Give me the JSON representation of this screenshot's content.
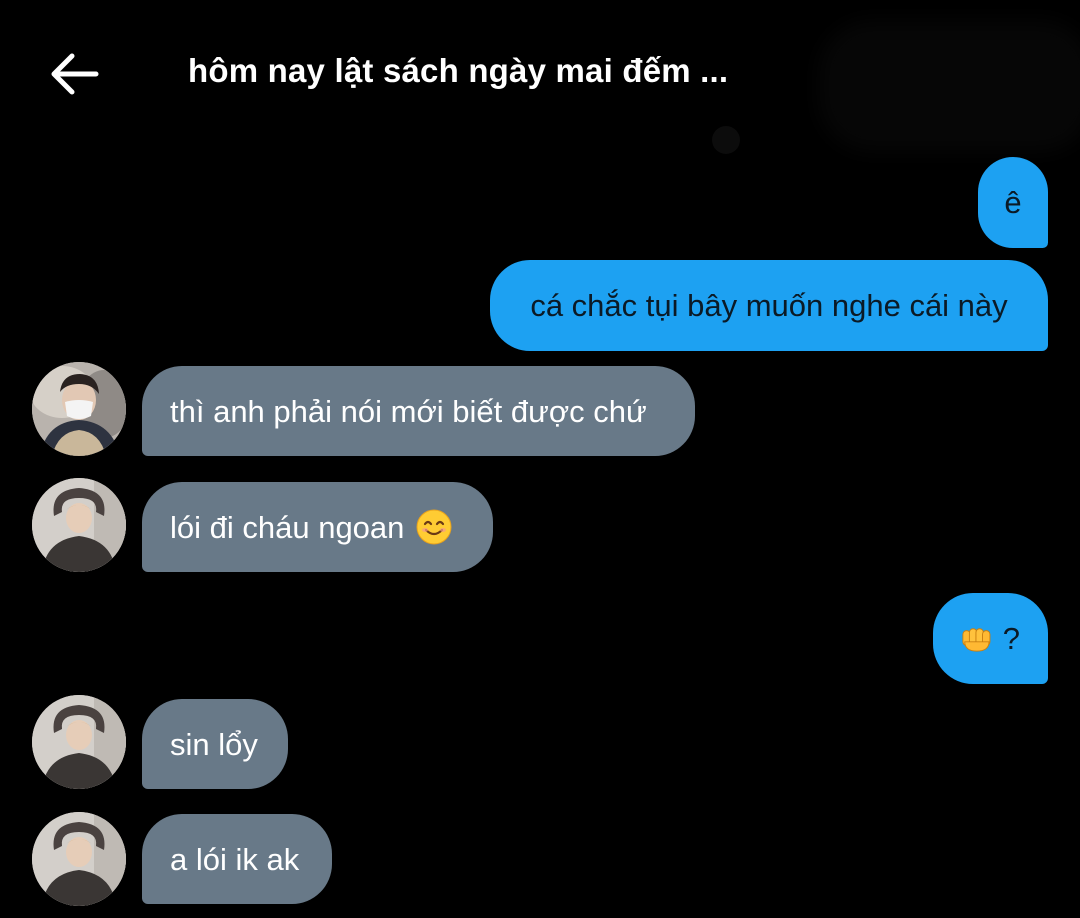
{
  "header": {
    "back_icon": "arrow-left-icon",
    "title": "hôm nay lật sách ngày mai đếm ..."
  },
  "colors": {
    "background": "#000000",
    "sent_bubble": "#1da1f2",
    "received_bubble": "#687988"
  },
  "messages": [
    {
      "side": "sent",
      "text": "ê"
    },
    {
      "side": "sent",
      "text": "cá chắc tụi bây muốn nghe cái này"
    },
    {
      "side": "received",
      "text": "thì anh phải nói mới biết được chứ",
      "avatar": "avatar-masked-user"
    },
    {
      "side": "received",
      "text": "lói đi cháu ngoan",
      "emoji": "smiling-face-icon",
      "avatar": "avatar-heart-pose"
    },
    {
      "side": "sent",
      "text": "?",
      "emoji": "oncoming-fist-icon"
    },
    {
      "side": "received",
      "text": "sin lổy",
      "avatar": "avatar-heart-pose"
    },
    {
      "side": "received",
      "text": "a lói ik ak",
      "avatar": "avatar-heart-pose"
    }
  ]
}
